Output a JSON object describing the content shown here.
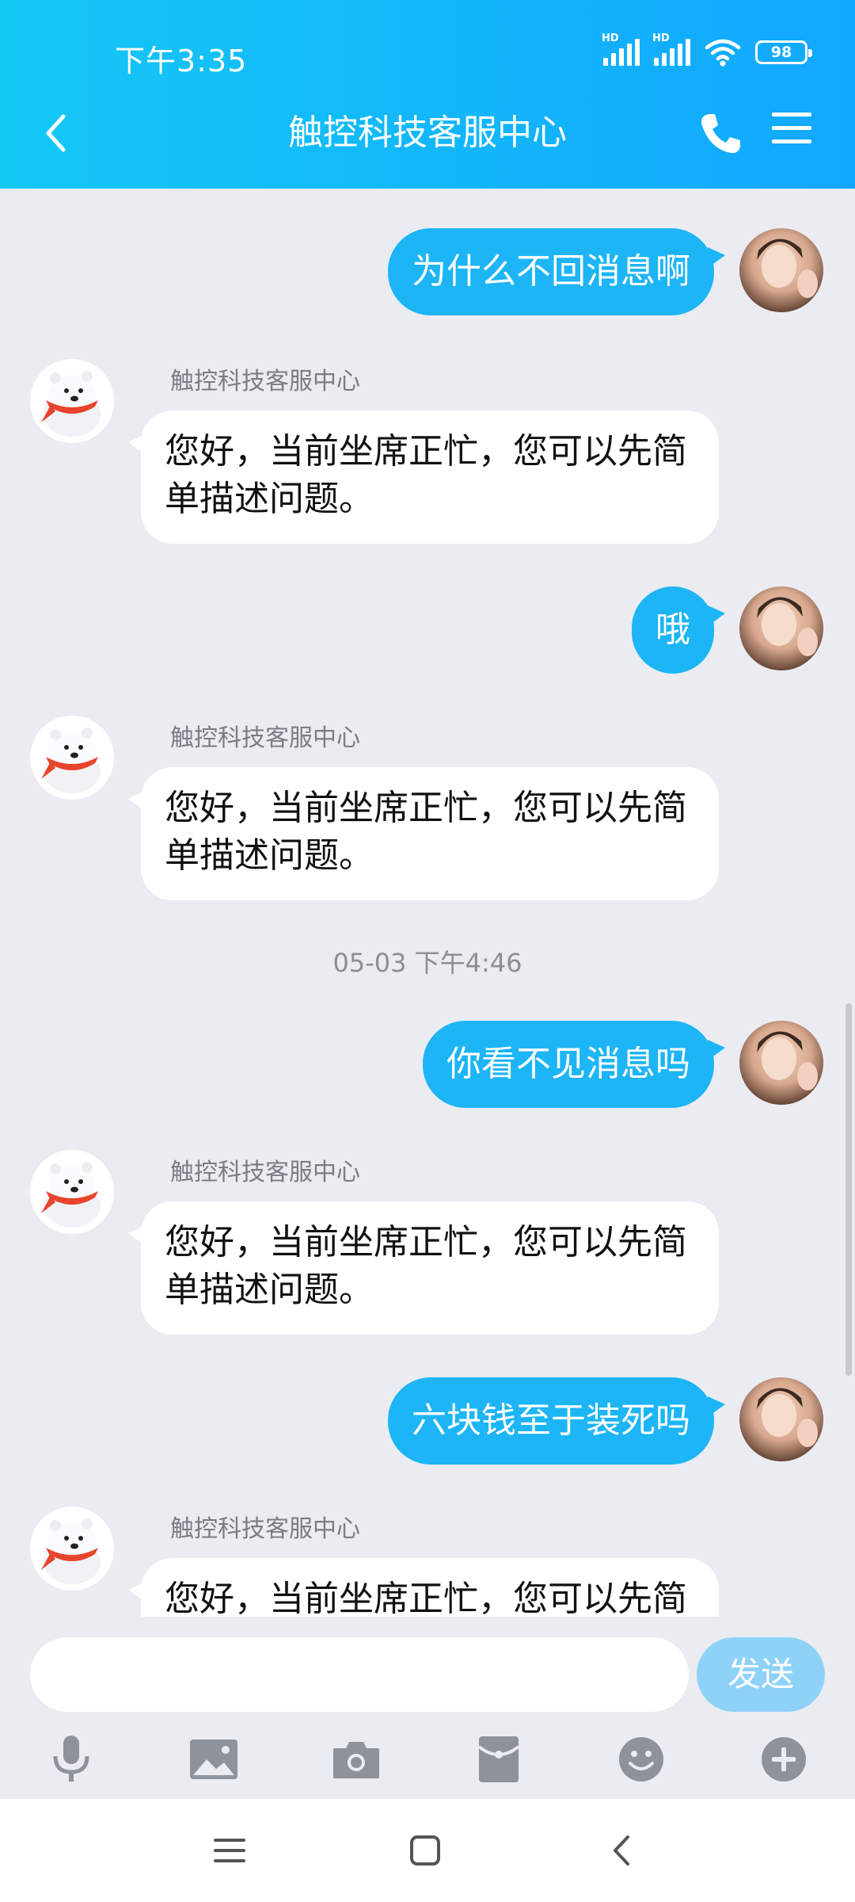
{
  "status_bar": {
    "time": "下午3:35",
    "signal_label": "HD",
    "battery": "98"
  },
  "header": {
    "title": "触控科技客服中心"
  },
  "messages": [
    {
      "type": "outgoing",
      "text": "为什么不回消息啊"
    },
    {
      "type": "incoming",
      "sender": "触控科技客服中心",
      "text": "您好，当前坐席正忙，您可以先简单描述问题。"
    },
    {
      "type": "outgoing",
      "text": "哦"
    },
    {
      "type": "incoming",
      "sender": "触控科技客服中心",
      "text": "您好，当前坐席正忙，您可以先简单描述问题。"
    },
    {
      "type": "timestamp",
      "text": "05-03 下午4:46"
    },
    {
      "type": "outgoing",
      "text": "你看不见消息吗"
    },
    {
      "type": "incoming",
      "sender": "触控科技客服中心",
      "text": "您好，当前坐席正忙，您可以先简单描述问题。"
    },
    {
      "type": "outgoing",
      "text": "六块钱至于装死吗"
    },
    {
      "type": "incoming",
      "sender": "触控科技客服中心",
      "text": "您好，当前坐席正忙，您可以先简单描述问题。"
    }
  ],
  "input": {
    "value": "",
    "placeholder": "",
    "send_label": "发送"
  },
  "toolbar": [
    "microphone-icon",
    "image-icon",
    "camera-icon",
    "red-packet-icon",
    "emoji-icon",
    "plus-icon"
  ],
  "colors": {
    "header_start": "#14c8f5",
    "header_end": "#12a7ff",
    "outgoing_bubble": "#1db5f5",
    "send_button": "#8fd2f8",
    "background": "#eaecf2"
  }
}
